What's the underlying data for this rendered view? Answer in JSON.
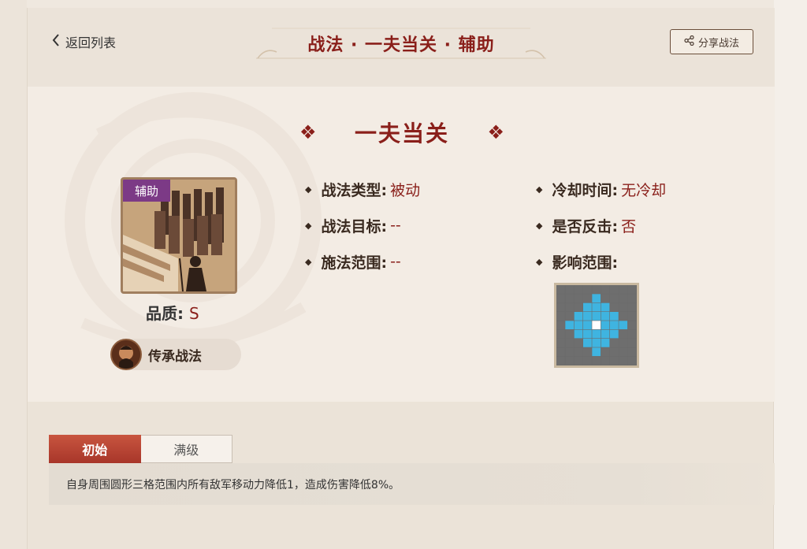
{
  "header": {
    "back_label": "返回列表",
    "title": "战法 · 一夫当关 · 辅助",
    "share_label": "分享战法"
  },
  "skill": {
    "name": "一夫当关",
    "tag": "辅助",
    "quality_label": "品质:",
    "quality_value": "S",
    "inherit_label": "传承战法"
  },
  "attributes": {
    "left": [
      {
        "label": "战法类型:",
        "value": "被动"
      },
      {
        "label": "战法目标:",
        "value": "--"
      },
      {
        "label": "施法范围:",
        "value": "--"
      }
    ],
    "right": [
      {
        "label": "冷却时间:",
        "value": "无冷却"
      },
      {
        "label": "是否反击:",
        "value": "否"
      },
      {
        "label": "影响范围:",
        "value": ""
      }
    ]
  },
  "tabs": [
    {
      "label": "初始",
      "active": true
    },
    {
      "label": "满级",
      "active": false
    }
  ],
  "description": "自身周围圆形三格范围内所有敌军移动力降低1，造成伤害降低8%。",
  "colors": {
    "accent": "#8a1f1a",
    "tab_active": "#b4432f",
    "tag_purple": "#7c3a86",
    "range_cell": "#3fb4e0"
  }
}
